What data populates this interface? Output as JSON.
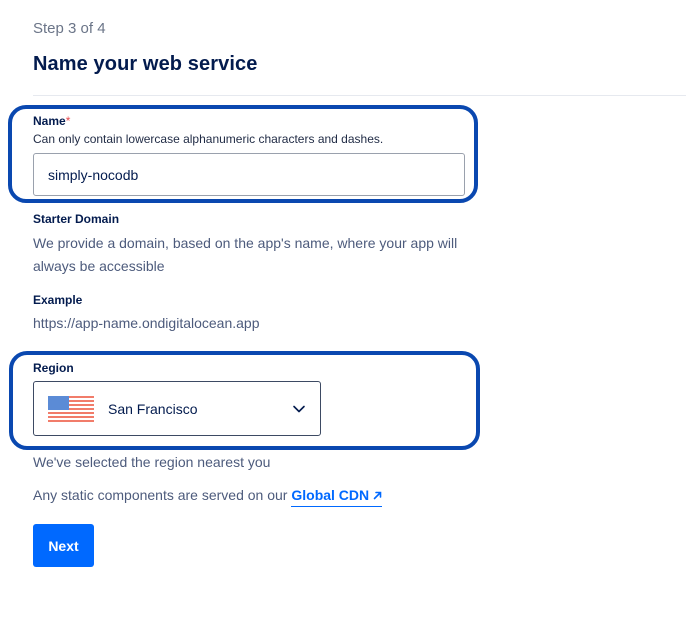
{
  "step": "Step 3 of 4",
  "title": "Name your web service",
  "name_field": {
    "label": "Name",
    "required_mark": "*",
    "helper": "Can only contain lowercase alphanumeric characters and dashes.",
    "value": "simply-nocodb"
  },
  "starter_domain": {
    "label": "Starter Domain",
    "line1": "We provide a domain, based on the app's name, where your app will",
    "line2": "always be accessible"
  },
  "example": {
    "label": "Example",
    "url": "https://app-name.ondigitalocean.app"
  },
  "region": {
    "label": "Region",
    "selected": "San Francisco",
    "flag_icon": "us-flag-icon",
    "note": "We've selected the region nearest you"
  },
  "cdn": {
    "text": "Any static components are served on our",
    "link_label": "Global CDN",
    "link_icon": "external-link-icon"
  },
  "next_button": "Next",
  "colors": {
    "primary": "#0069ff",
    "highlight": "#0a48b0",
    "heading": "#031b4e"
  }
}
